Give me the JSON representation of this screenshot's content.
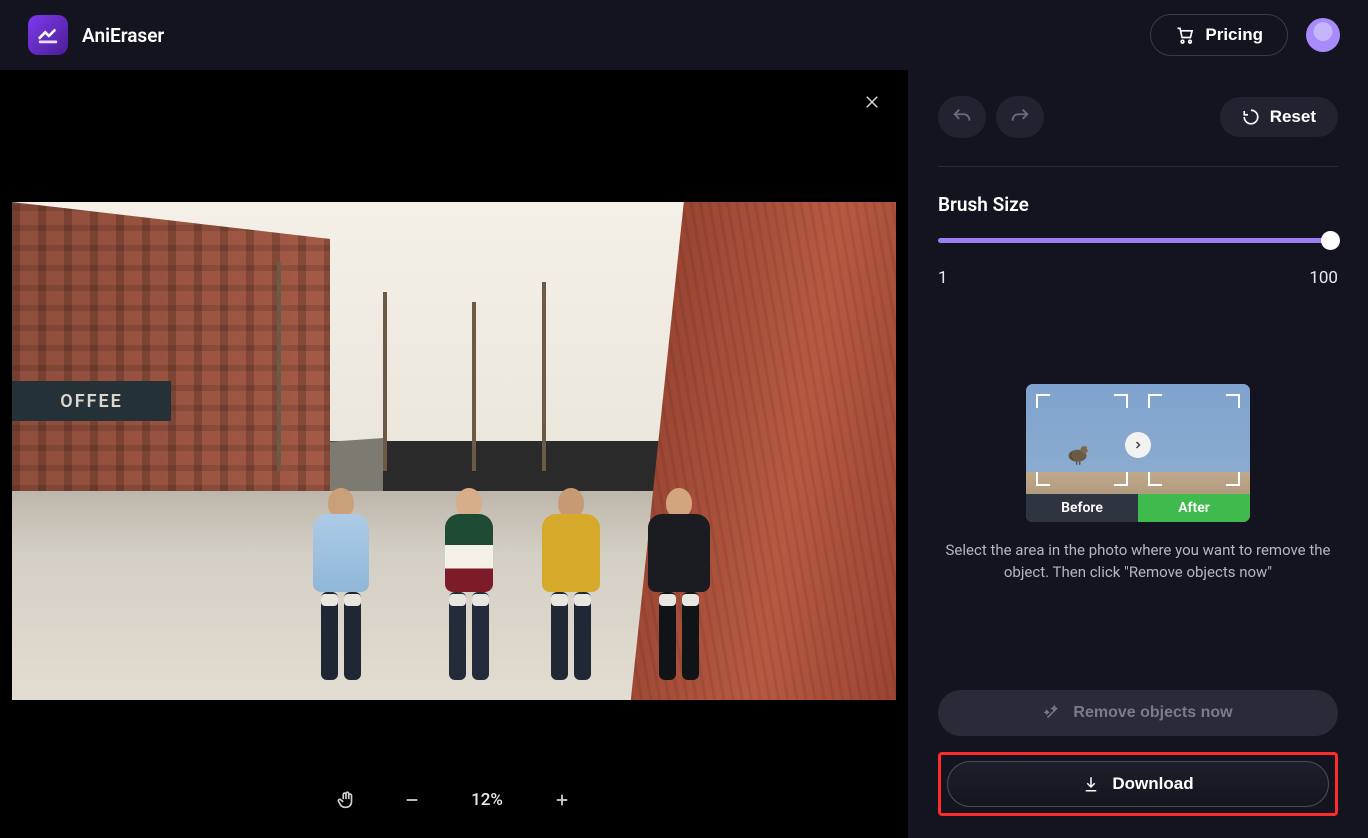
{
  "header": {
    "app_name": "AniEraser",
    "pricing_label": "Pricing"
  },
  "canvas": {
    "awning_text": "OFFEE",
    "zoom_percent": "12%"
  },
  "panel": {
    "reset_label": "Reset",
    "brush_size_label": "Brush Size",
    "brush_min": "1",
    "brush_max": "100",
    "brush_value": 100,
    "tutorial": {
      "before_label": "Before",
      "after_label": "After",
      "help_text": "Select the area in the photo where you want to remove the object. Then click \"Remove objects now\""
    },
    "remove_label": "Remove objects now",
    "download_label": "Download"
  },
  "colors": {
    "accent": "#8b5cf6",
    "highlight": "#ff2a2a",
    "success": "#3fba4c"
  }
}
